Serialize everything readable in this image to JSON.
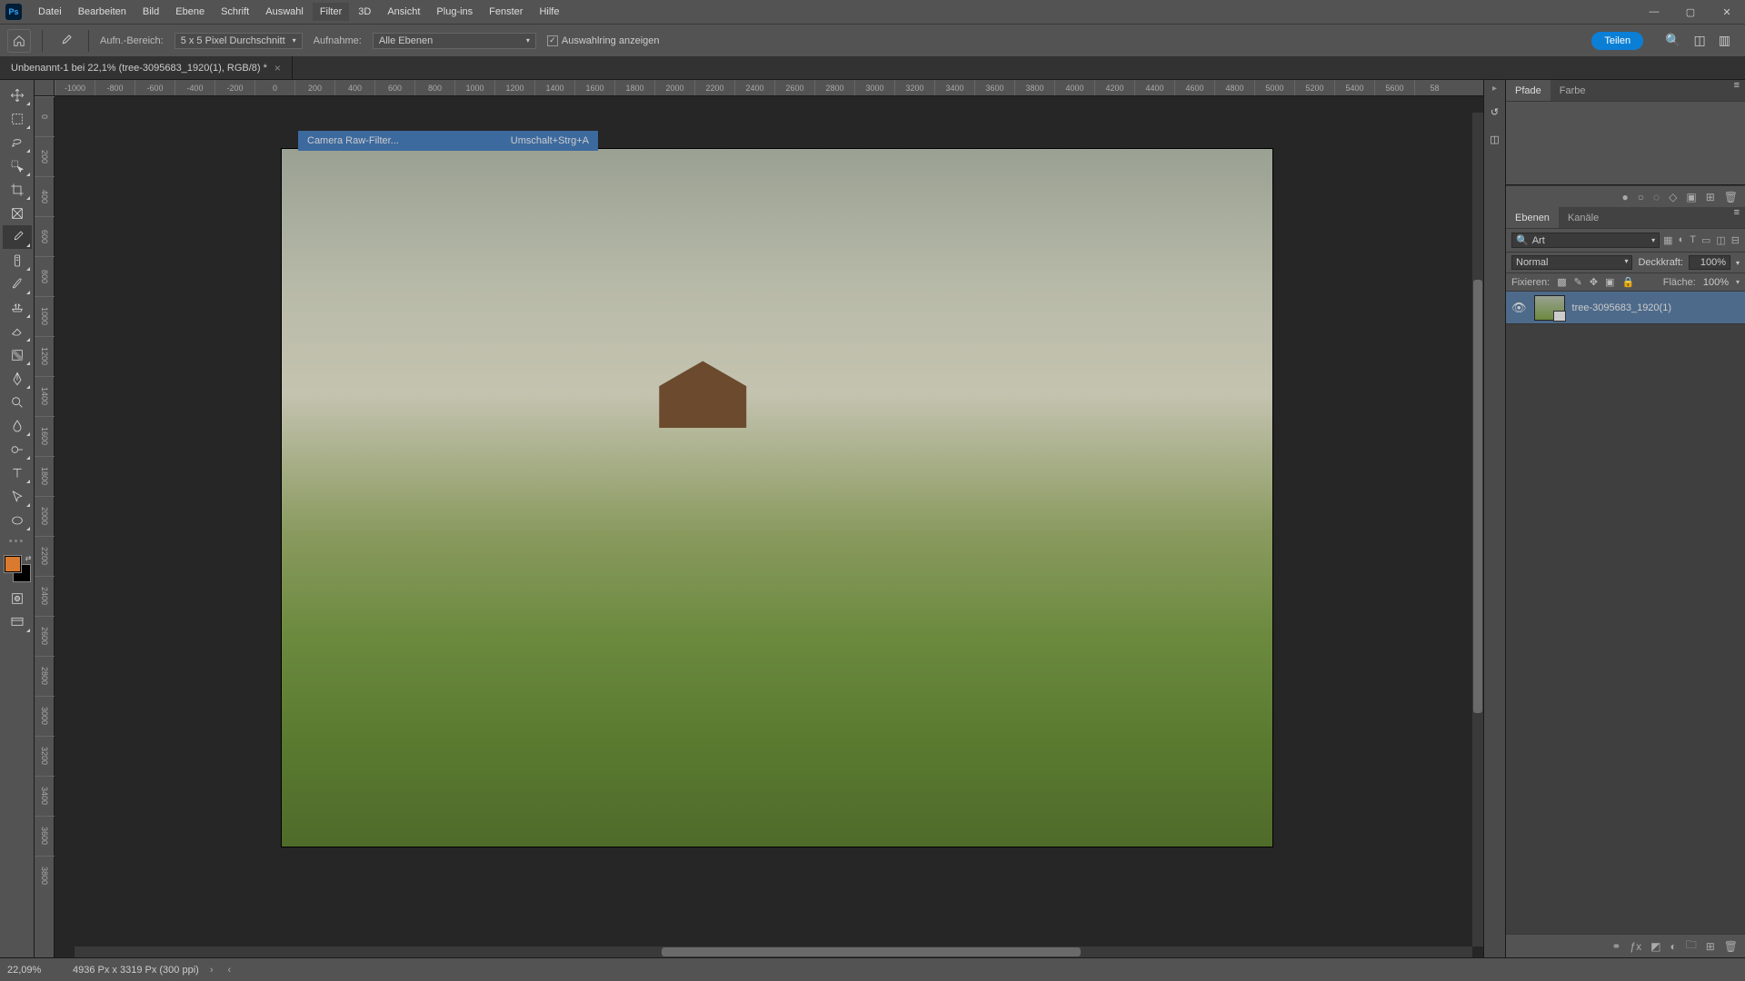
{
  "menubar": {
    "items": [
      "Datei",
      "Bearbeiten",
      "Bild",
      "Ebene",
      "Schrift",
      "Auswahl",
      "Filter",
      "3D",
      "Ansicht",
      "Plug-ins",
      "Fenster",
      "Hilfe"
    ],
    "active_index": 6
  },
  "options_bar": {
    "sample_label": "Aufn.-Bereich:",
    "sample_value": "5 x 5 Pixel Durchschnitt",
    "sample2_label": "Aufnahme:",
    "sample2_value": "Alle Ebenen",
    "checkbox_label": "Auswahlring anzeigen",
    "checkbox_checked": true,
    "share_label": "Teilen"
  },
  "document_tab": {
    "title": "Unbenannt-1 bei 22,1% (tree-3095683_1920(1), RGB/8) *"
  },
  "tooltip": {
    "left": "Camera Raw-Filter...",
    "right": "Umschalt+Strg+A"
  },
  "ruler_ticks": [
    "-1000",
    "-800",
    "-600",
    "-400",
    "-200",
    "0",
    "200",
    "400",
    "600",
    "800",
    "1000",
    "1200",
    "1400",
    "1600",
    "1800",
    "2000",
    "2200",
    "2400",
    "2600",
    "2800",
    "3000",
    "3200",
    "3400",
    "3600",
    "3800",
    "4000",
    "4200",
    "4400",
    "4600",
    "4800",
    "5000",
    "5200",
    "5400",
    "5600",
    "58"
  ],
  "panels": {
    "top_tabs": [
      "Pfade",
      "Farbe"
    ],
    "top_active": 0,
    "layers_tabs": [
      "Ebenen",
      "Kanäle"
    ],
    "layers_active": 0,
    "search_placeholder": "Art",
    "blend_mode": "Normal",
    "opacity_label": "Deckkraft:",
    "opacity_value": "100%",
    "lock_label": "Fixieren:",
    "fill_label": "Fläche:",
    "fill_value": "100%",
    "layer_name": "tree-3095683_1920(1)"
  },
  "statusbar": {
    "zoom": "22,09%",
    "doc_info": "4936 Px x 3319 Px (300 ppi)"
  },
  "colors": {
    "foreground": "#d97a2e",
    "background": "#000000"
  }
}
